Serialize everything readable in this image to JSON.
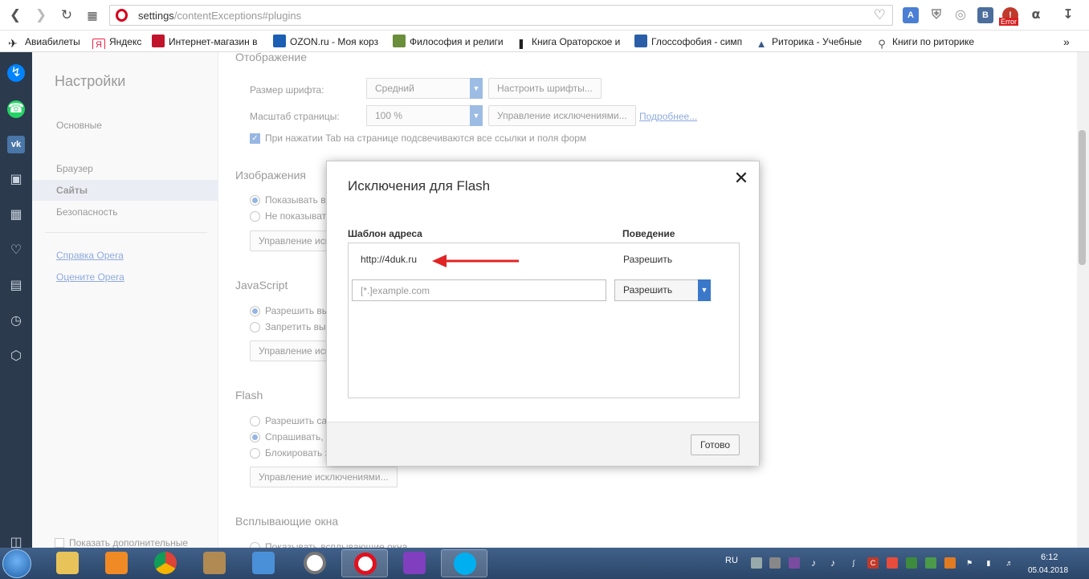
{
  "address_bar": {
    "url_main": "settings",
    "url_rest": "/contentExceptions#plugins"
  },
  "extensions": {
    "error_badge": "Error"
  },
  "bookmarks": [
    {
      "label": "Авиабилеты",
      "icon": "plane-icon"
    },
    {
      "label": "Яндекс",
      "icon": "yandex-icon"
    },
    {
      "label": "Интернет-магазин в",
      "icon": "shop-icon"
    },
    {
      "label": "OZON.ru - Моя корз",
      "icon": "ozon-icon"
    },
    {
      "label": "Философия и религи",
      "icon": "book-icon"
    },
    {
      "label": "Книга Ораторское и",
      "icon": "speaker-icon"
    },
    {
      "label": "Глоссофобия - симп",
      "icon": "info-icon"
    },
    {
      "label": "Риторика - Учебные",
      "icon": "hat-icon"
    },
    {
      "label": "Книги по риторике",
      "icon": "search-icon"
    }
  ],
  "bookmarks_more": "»",
  "settings_nav": {
    "title": "Настройки",
    "items": [
      "Основные",
      "Браузер",
      "Сайты",
      "Безопасность"
    ],
    "links": [
      "Справка Opera",
      "Оцените Opera"
    ],
    "advanced": "Показать дополнительные"
  },
  "main": {
    "display": {
      "title": "Отображение",
      "font_size_label": "Размер шрифта:",
      "font_size_value": "Средний",
      "font_customize": "Настроить шрифты...",
      "zoom_label": "Масштаб страницы:",
      "zoom_value": "100 %",
      "zoom_exceptions": "Управление исключениями...",
      "more_link": "Подробнее...",
      "tab_highlight": "При нажатии Tab на странице подсвечиваются все ссылки и поля форм"
    },
    "images": {
      "title": "Изображения",
      "option_show": "Показывать вс",
      "option_hide": "Не показыват",
      "manage": "Управление искл"
    },
    "javascript": {
      "title": "JavaScript",
      "option_allow": "Разрешить вы",
      "option_block": "Запретить вы",
      "manage": "Управление искл"
    },
    "flash": {
      "title": "Flash",
      "option_allow": "Разрешить са",
      "option_ask": "Спрашивать, п",
      "option_block": "Блокировать з",
      "manage": "Управление исключениями..."
    },
    "popups": {
      "title": "Всплывающие окна",
      "option_allow": "Показывать всплывающие окна"
    }
  },
  "dialog": {
    "title": "Исключения для Flash",
    "close": "✕",
    "col_pattern": "Шаблон адреса",
    "col_behavior": "Поведение",
    "exception": {
      "pattern": "http://4duk.ru",
      "behavior": "Разрешить"
    },
    "new_placeholder": "[*.]example.com",
    "new_behavior": "Разрешить",
    "done": "Готово"
  },
  "taskbar": {
    "lang": "RU",
    "time": "6:12",
    "date": "05.04.2018"
  }
}
